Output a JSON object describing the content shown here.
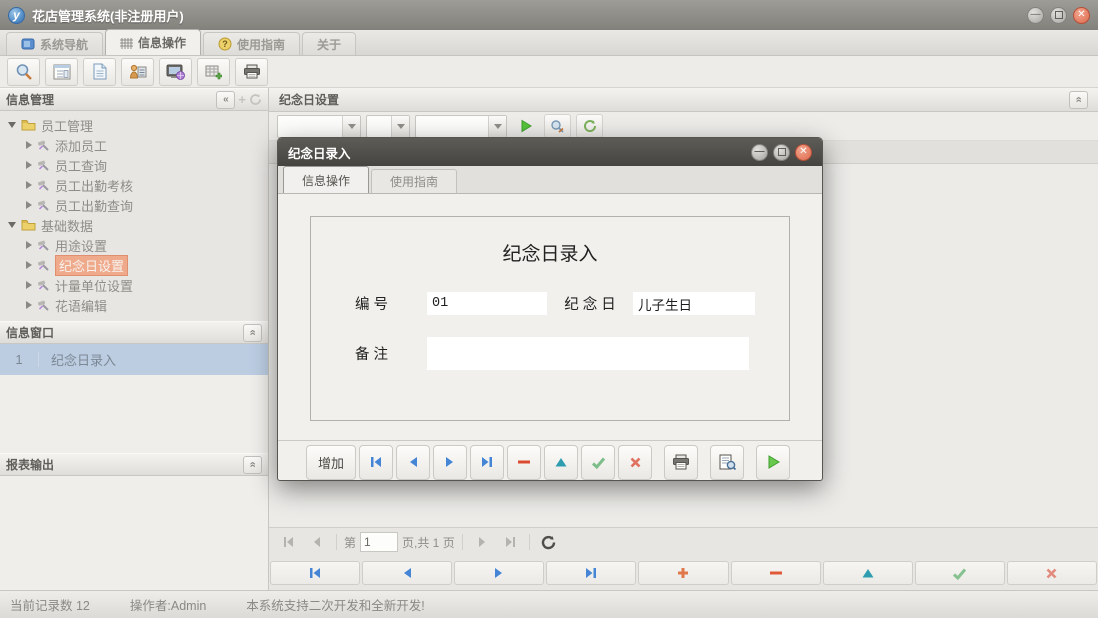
{
  "window": {
    "logo_letter": "y",
    "title": "花店管理系统(非注册用户)"
  },
  "tabs": {
    "t1": "系统导航",
    "t2": "信息操作",
    "t3": "使用指南",
    "t4": "关于"
  },
  "sidebar": {
    "info_panel": {
      "title": "信息管理"
    },
    "tree": {
      "group1": {
        "label": "员工管理",
        "children": [
          "添加员工",
          "员工查询",
          "员工出勤考核",
          "员工出勤查询"
        ]
      },
      "group2": {
        "label": "基础数据",
        "children": [
          "用途设置",
          "纪念日设置",
          "计量单位设置",
          "花语编辑"
        ],
        "selected": "纪念日设置"
      }
    },
    "window_panel": {
      "title": "信息窗口",
      "row": {
        "index": "1",
        "label": "纪念日录入"
      }
    },
    "report_panel": {
      "title": "报表输出"
    }
  },
  "main": {
    "title": "纪念日设置",
    "pager": {
      "prefix": "第",
      "page": "1",
      "suffix": "页,共 1 页"
    }
  },
  "dialog": {
    "title": "纪念日录入",
    "tabs": {
      "t1": "信息操作",
      "t2": "使用指南"
    },
    "form": {
      "title": "纪念日录入",
      "f1_label": "编  号",
      "f1_value": "01",
      "f2_label": "纪 念 日",
      "f2_value": "儿子生日",
      "f3_label": "备  注",
      "f3_value": ""
    },
    "add_button": "增加"
  },
  "statusbar": {
    "records": "当前记录数 12",
    "operator": "操作者:Admin",
    "message": "本系统支持二次开发和全新开发!"
  },
  "colors": {
    "accent_blue": "#4585d6",
    "accent_orange": "#e05a38",
    "accent_teal": "#2f9db0",
    "accent_green": "#86c290",
    "accent_red": "#e38a7e",
    "selected_tree": "#efa98b",
    "selected_row": "#bccde2",
    "dialog_titlebar": "#4b4a46"
  }
}
